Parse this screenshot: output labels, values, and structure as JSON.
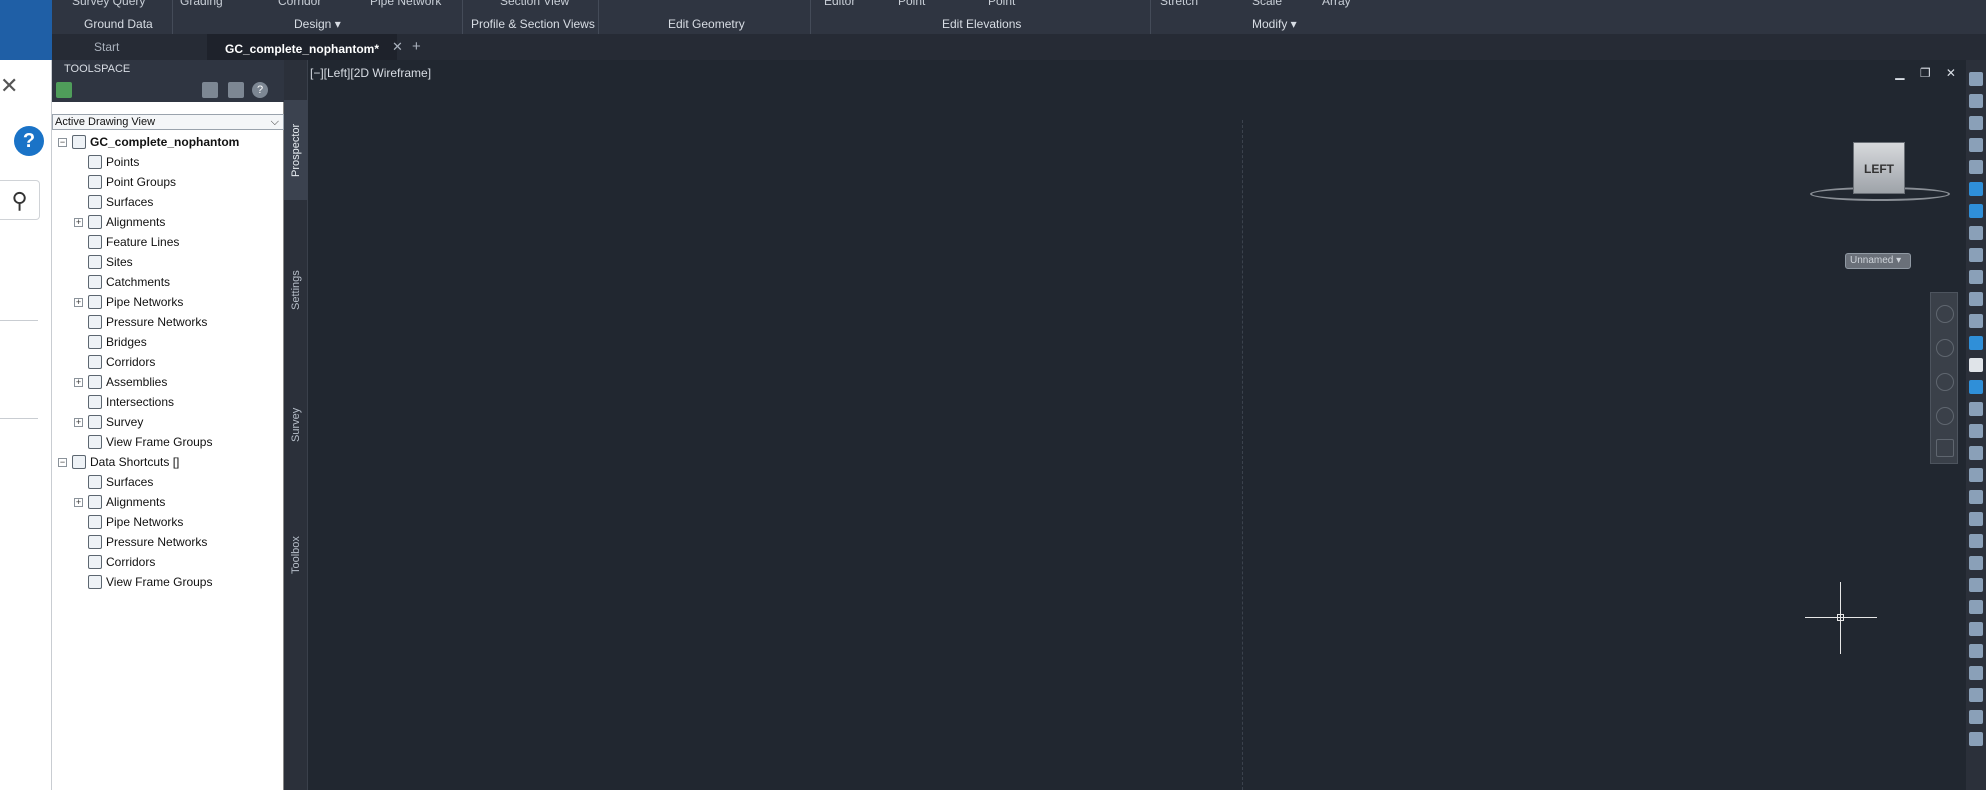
{
  "ribbon": {
    "top_items": [
      "Survey Query",
      "Grading",
      "Corridor",
      "Pipe Network",
      "Section View",
      "Editor",
      "Point",
      "Point",
      "Stretch",
      "Scale",
      "Array"
    ],
    "panels": [
      "Ground Data",
      "Design",
      "Profile & Section Views",
      "Edit Geometry",
      "Edit Elevations",
      "Modify"
    ]
  },
  "tabs": {
    "start": "Start",
    "doc": "GC_complete_nophantom*",
    "close_glyph": "✕",
    "add_glyph": "+"
  },
  "toolspace": {
    "title": "TOOLSPACE",
    "dropdown_value": "Active Drawing View",
    "tree": {
      "root": "GC_complete_nophantom",
      "items": [
        "Points",
        "Point Groups",
        "Surfaces",
        "Alignments",
        "Feature Lines",
        "Sites",
        "Catchments",
        "Pipe Networks",
        "Pressure Networks",
        "Bridges",
        "Corridors",
        "Assemblies",
        "Intersections",
        "Survey",
        "View Frame Groups"
      ],
      "shortcuts_root": "Data Shortcuts []",
      "shortcut_items": [
        "Surfaces",
        "Alignments",
        "Pipe Networks",
        "Pressure Networks",
        "Corridors",
        "View Frame Groups"
      ]
    },
    "vertical_tabs": [
      "Prospector",
      "Settings",
      "Survey",
      "Toolbox"
    ]
  },
  "viewport": {
    "label": "[−][Left][2D Wireframe]",
    "controls": "▁ ❐ ✕",
    "viewcube_face": "LEFT",
    "ucs_name": "Unnamed"
  },
  "dialog": {
    "close_glyph": "✕",
    "help_glyph": "?",
    "search_glyph": "⚲"
  },
  "colors": {
    "accent": "#1f5fa6",
    "background": "#212730"
  }
}
